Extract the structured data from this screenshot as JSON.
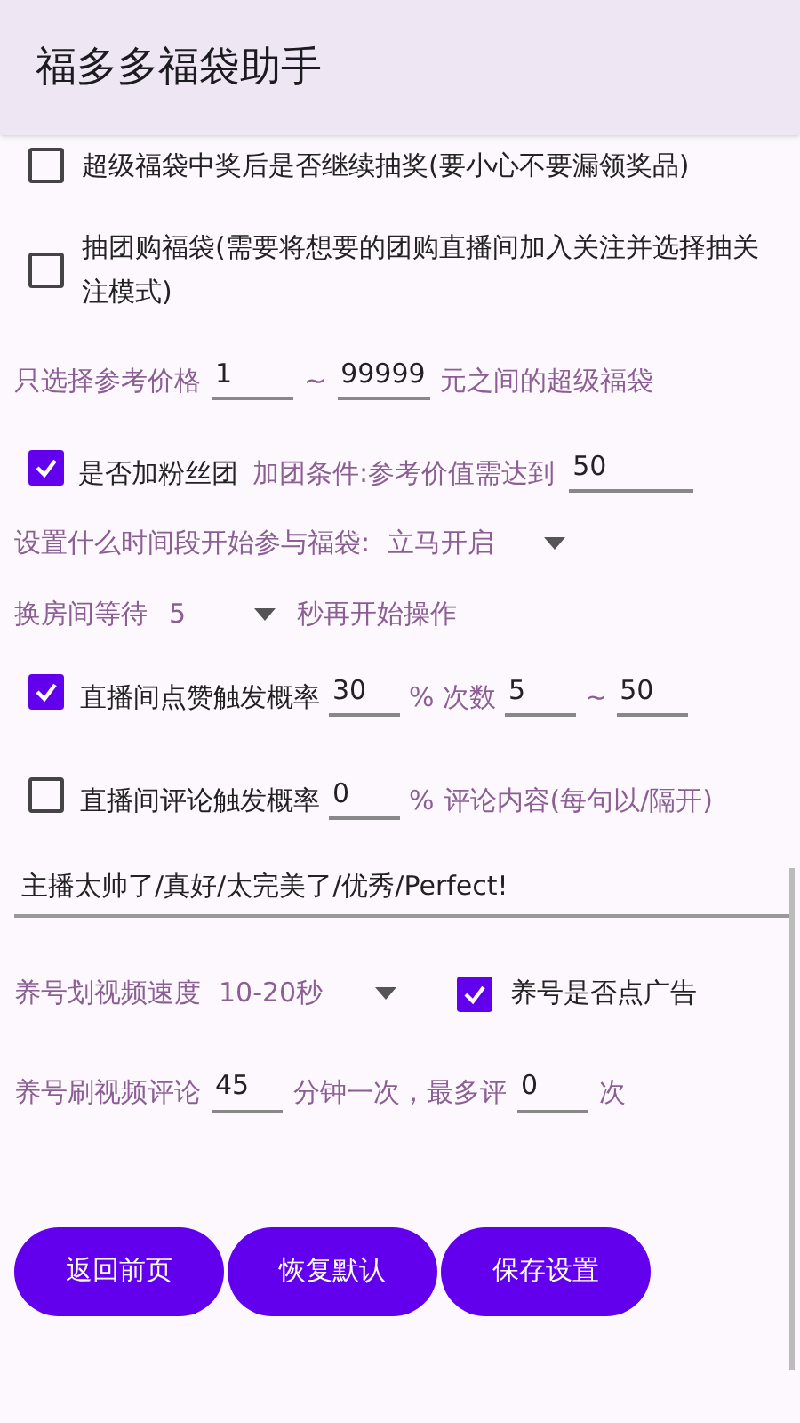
{
  "app_bar": {
    "title": "福多多福袋助手"
  },
  "options": [
    {
      "label": "超级福袋中奖后是否继续抽奖(要小心不要漏领奖品)",
      "checked": false
    },
    {
      "label": "抽团购福袋(需要将想要的团购直播间加入关注并选择抽关注模式)",
      "checked": false
    }
  ],
  "price_range": {
    "label": "只选择参考价格",
    "min": "1",
    "separator": "~",
    "max": "99999",
    "suffix": "元之间的超级福袋"
  },
  "fan_club": {
    "label": "是否加粉丝团",
    "checked": true,
    "condition": "加团条件:参考价值需达到",
    "value": "50"
  },
  "start_time": {
    "label": "设置什么时间段开始参与福袋:",
    "value": "立马开启"
  },
  "room_wait": {
    "label": "换房间等待",
    "value": "5",
    "suffix": "秒再开始操作"
  },
  "like": {
    "label": "直播间点赞触发概率",
    "checked": true,
    "rate": "30",
    "unit": "% 次数",
    "min": "5",
    "separator": "~",
    "max": "50"
  },
  "comment": {
    "label": "直播间评论触发概率",
    "checked": false,
    "rate": "0",
    "unit": "%",
    "hint": "评论内容(每句以/隔开)",
    "content": "主播太帅了/真好/太完美了/优秀/Perfect!"
  },
  "video_speed": {
    "label": "养号划视频速度",
    "value": "10-20秒",
    "ad_label": "养号是否点广告",
    "ad_checked": true
  },
  "video_comment": {
    "label": "养号刷视频评论",
    "interval": "45",
    "interval_suffix": "分钟一次，最多评",
    "max": "0",
    "max_suffix": "次"
  },
  "buttons": [
    "返回前页",
    "恢复默认",
    "保存设置"
  ]
}
